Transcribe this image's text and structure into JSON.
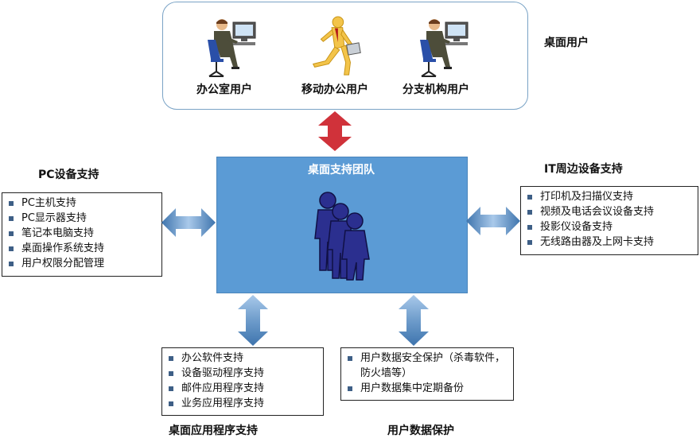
{
  "desktop_users": {
    "title": "桌面用户",
    "users": [
      {
        "label": "办公室用户",
        "icon": "office-worker-icon"
      },
      {
        "label": "移动办公用户",
        "icon": "mobile-worker-icon"
      },
      {
        "label": "分支机构用户",
        "icon": "branch-worker-icon"
      }
    ]
  },
  "team": {
    "title": "桌面支持团队",
    "icon": "team-people-icon"
  },
  "pc_support": {
    "title": "PC设备支持",
    "items": [
      "PC主机支持",
      "PC显示器支持",
      "笔记本电脑支持",
      "桌面操作系统支持",
      "用户权限分配管理"
    ]
  },
  "it_support": {
    "title": "IT周边设备支持",
    "items": [
      "打印机及扫描仪支持",
      "视频及电话会议设备支持",
      "投影仪设备支持",
      "无线路由器及上网卡支持"
    ]
  },
  "app_support": {
    "title": "桌面应用程序支持",
    "items": [
      "办公软件支持",
      "设备驱动程序支持",
      "邮件应用程序支持",
      "业务应用程序支持"
    ]
  },
  "data_protection": {
    "title": "用户数据保护",
    "items": [
      "用户数据安全保护（杀毒软件，防火墙等）",
      "用户数据集中定期备份"
    ]
  },
  "colors": {
    "team_box": "#5b9bd5",
    "red_arrow": "#d0323a",
    "blue_arrow": "#4f86bd",
    "people": "#2b2f8f"
  }
}
